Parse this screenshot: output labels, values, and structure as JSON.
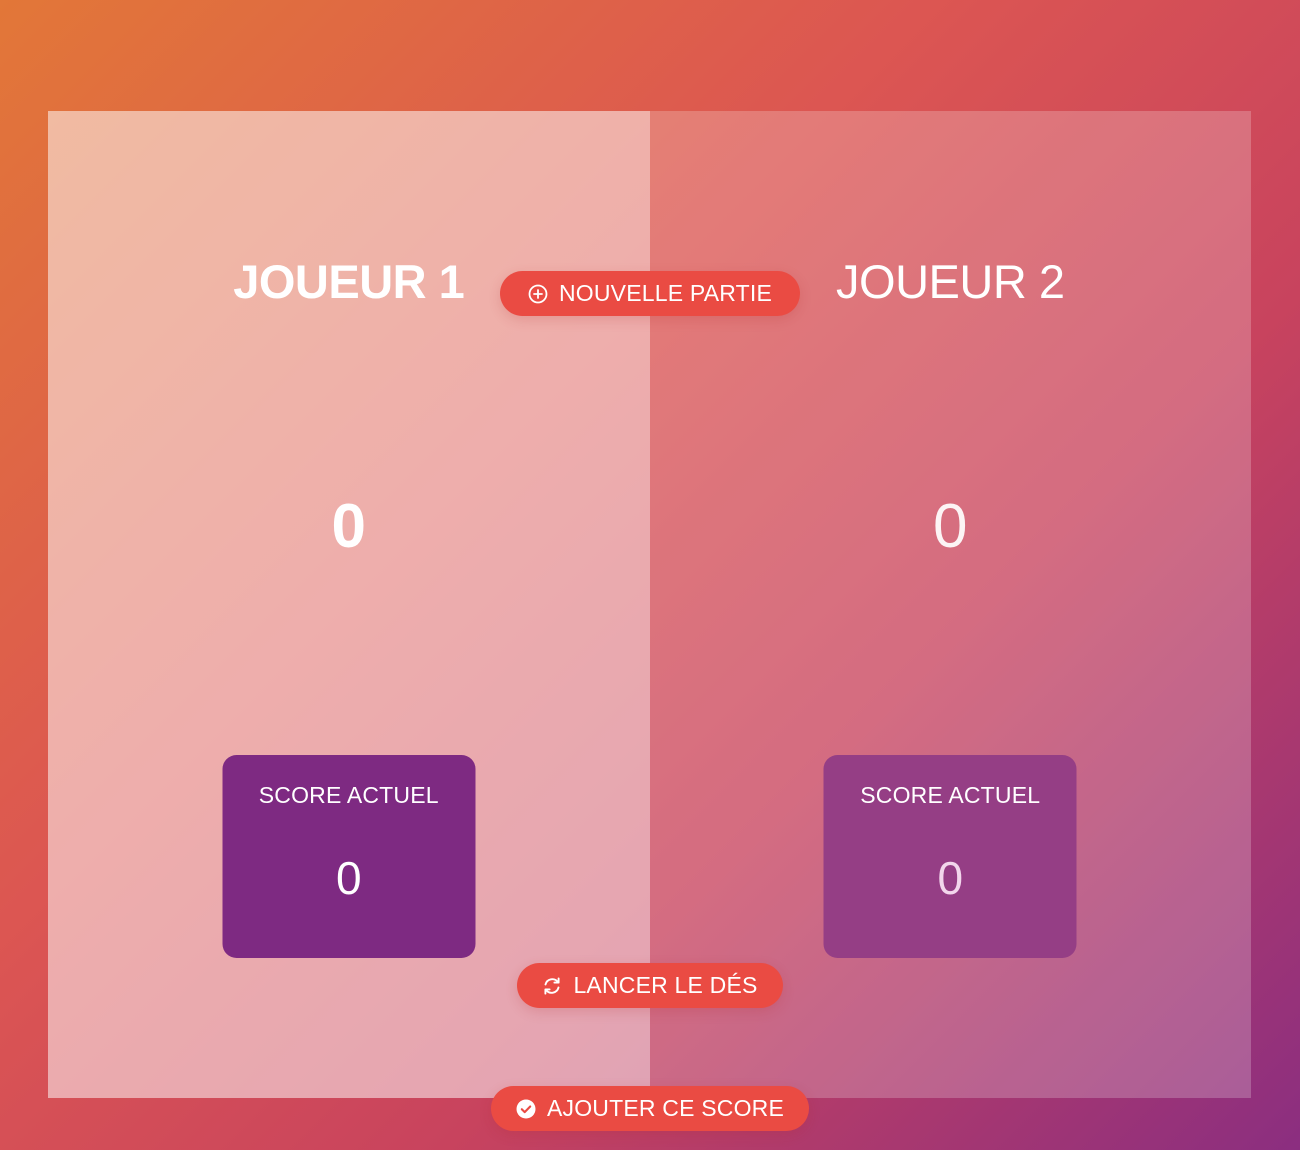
{
  "actions": {
    "new_game": {
      "label": "NOUVELLE PARTIE",
      "icon": "plus-circle-icon"
    },
    "roll": {
      "label": "LANCER LE DÉS",
      "icon": "refresh-icon"
    },
    "hold": {
      "label": "AJOUTER CE SCORE",
      "icon": "check-circle-icon"
    }
  },
  "players": [
    {
      "name": "JOUEUR 1",
      "global_score": "0",
      "current_label": "SCORE ACTUEL",
      "current_score": "0",
      "active": true
    },
    {
      "name": "JOUEUR 2",
      "global_score": "0",
      "current_label": "SCORE ACTUEL",
      "current_score": "0",
      "active": false
    }
  ],
  "colors": {
    "button": "#ea4b43",
    "current_box_active": "#7e2a82",
    "current_box_inactive": "#953e85",
    "background_start": "#e27738",
    "background_end": "#8b2e80"
  }
}
